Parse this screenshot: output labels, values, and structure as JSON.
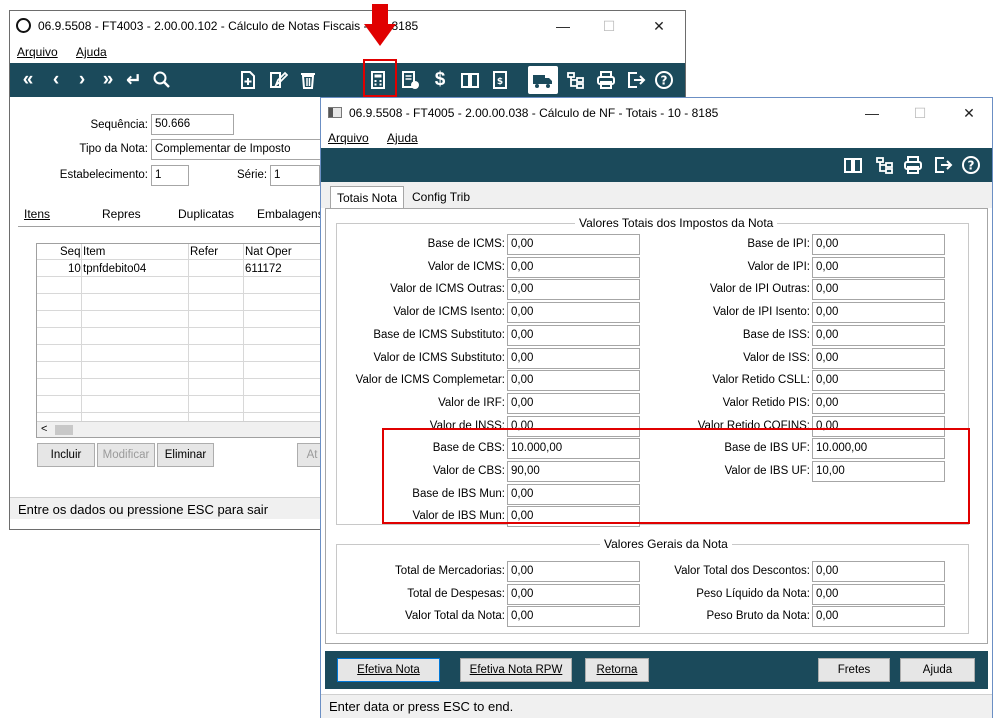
{
  "back_window": {
    "title": "06.9.5508 - FT4003 - 2.00.00.102 - Cálculo de Notas Fiscais - ... - 8185",
    "menu": {
      "arquivo": "Arquivo",
      "ajuda": "Ajuda"
    },
    "fields": {
      "sequencia": {
        "label": "Sequência:",
        "value": "50.666"
      },
      "tipo_nota": {
        "label": "Tipo da Nota:",
        "value": "Complementar de Imposto"
      },
      "estabelecimento": {
        "label": "Estabelecimento:",
        "value": "1"
      },
      "serie": {
        "label": "Série:",
        "value": "1"
      }
    },
    "tabs": [
      "Itens",
      "Repres",
      "Duplicatas",
      "Embalagens"
    ],
    "grid": {
      "columns": [
        "Seq",
        "Item",
        "Refer",
        "Nat Oper"
      ],
      "rows": [
        {
          "seq": "10",
          "item": "tpnfdebito04",
          "refer": "",
          "nat_oper": "611172"
        }
      ]
    },
    "buttons": {
      "incluir": "Incluir",
      "modificar": "Modificar",
      "eliminar": "Eliminar",
      "at": "At"
    },
    "status": "Entre os dados ou pressione ESC para sair"
  },
  "front_window": {
    "title": "06.9.5508 - FT4005 - 2.00.00.038 - Cálculo de NF - Totais - 10 - 8185",
    "menu": {
      "arquivo": "Arquivo",
      "ajuda": "Ajuda"
    },
    "tabs": {
      "totais": "Totais Nota",
      "config": "Config Trib"
    },
    "group1_title": "Valores Totais dos Impostos da Nota",
    "left_fields": [
      {
        "label": "Base de ICMS:",
        "value": "0,00"
      },
      {
        "label": "Valor de ICMS:",
        "value": "0,00"
      },
      {
        "label": "Valor de ICMS Outras:",
        "value": "0,00"
      },
      {
        "label": "Valor de ICMS Isento:",
        "value": "0,00"
      },
      {
        "label": "Base de ICMS Substituto:",
        "value": "0,00"
      },
      {
        "label": "Valor de ICMS Substituto:",
        "value": "0,00"
      },
      {
        "label": "Valor de ICMS Complemetar:",
        "value": "0,00"
      },
      {
        "label": "Valor de IRF:",
        "value": "0,00"
      },
      {
        "label": "Valor de INSS:",
        "value": "0,00"
      },
      {
        "label": "Base de CBS:",
        "value": "10.000,00"
      },
      {
        "label": "Valor de CBS:",
        "value": "90,00"
      },
      {
        "label": "Base de IBS Mun:",
        "value": "0,00"
      },
      {
        "label": "Valor de IBS Mun:",
        "value": "0,00"
      }
    ],
    "right_fields": [
      {
        "label": "Base de IPI:",
        "value": "0,00"
      },
      {
        "label": "Valor de IPI:",
        "value": "0,00"
      },
      {
        "label": "Valor de IPI Outras:",
        "value": "0,00"
      },
      {
        "label": "Valor de IPI Isento:",
        "value": "0,00"
      },
      {
        "label": "Base de ISS:",
        "value": "0,00"
      },
      {
        "label": "Valor de ISS:",
        "value": "0,00"
      },
      {
        "label": "Valor Retido CSLL:",
        "value": "0,00"
      },
      {
        "label": "Valor Retido PIS:",
        "value": "0,00"
      },
      {
        "label": "Valor Retido COFINS:",
        "value": "0,00"
      },
      {
        "label": "Base de IBS UF:",
        "value": "10.000,00"
      },
      {
        "label": "Valor de IBS UF:",
        "value": "10,00"
      }
    ],
    "group2_title": "Valores Gerais da Nota",
    "gerais_left": [
      {
        "label": "Total de Mercadorias:",
        "value": "0,00"
      },
      {
        "label": "Total de Despesas:",
        "value": "0,00"
      },
      {
        "label": "Valor Total da Nota:",
        "value": "0,00"
      }
    ],
    "gerais_right": [
      {
        "label": "Valor Total dos Descontos:",
        "value": "0,00"
      },
      {
        "label": "Peso Líquido da Nota:",
        "value": "0,00"
      },
      {
        "label": "Peso Bruto da Nota:",
        "value": "0,00"
      }
    ],
    "buttons": {
      "efetiva": "Efetiva Nota",
      "efetiva_rpw": "Efetiva Nota RPW",
      "retorna": "Retorna",
      "fretes": "Fretes",
      "ajuda": "Ajuda"
    },
    "status": "Enter data or press ESC to end."
  },
  "colors": {
    "toolbar": "#1b4a5b",
    "highlight": "#e00000"
  }
}
